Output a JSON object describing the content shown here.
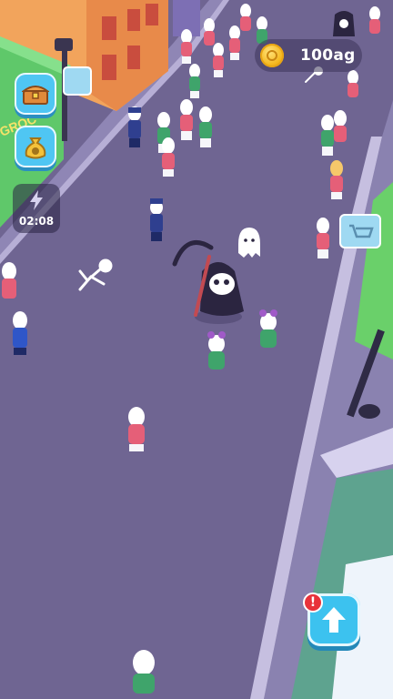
{
  "hud": {
    "coins": "100ag",
    "timer": "02:08",
    "shop_sign": "GROC"
  },
  "icons": {
    "coin": "coin-icon",
    "chest": "treasure-chest-icon",
    "bag": "money-bag-icon",
    "bolt": "lightning-bolt-icon",
    "upgrade": "up-arrow-icon",
    "alert": "exclamation-icon"
  },
  "colors": {
    "road": "#6f6592",
    "button": "#4fc6f3",
    "alert": "#e8323a",
    "coin": "#f5b820"
  }
}
